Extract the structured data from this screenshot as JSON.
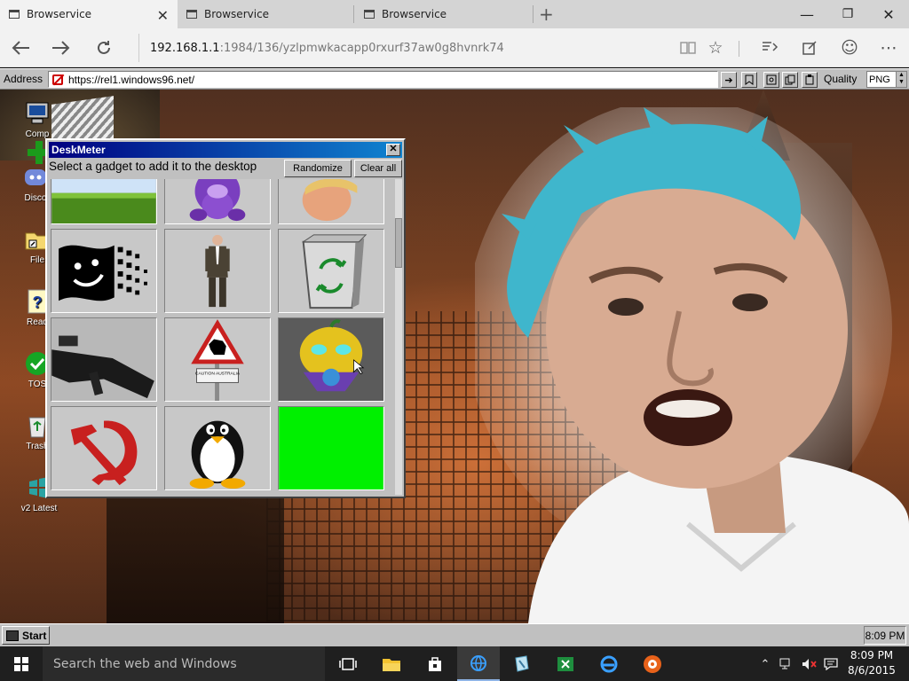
{
  "tabs": [
    {
      "title": "Browservice",
      "active": true
    },
    {
      "title": "Browservice",
      "active": false
    },
    {
      "title": "Browservice",
      "active": false
    }
  ],
  "window_controls": {
    "minimize": "—",
    "restore": "❐",
    "close": "✕"
  },
  "navbar": {
    "url_host": "192.168.1.1",
    "url_path": ":1984/136/yzlpmwkacapp0rxurf37aw0g8hvnrk74"
  },
  "w96_address": {
    "label": "Address",
    "url": "https://rel1.windows96.net/",
    "quality_label": "Quality",
    "format_value": "PNG"
  },
  "desktop_icons": [
    {
      "label": "Comp",
      "icon": "computer-icon"
    },
    {
      "label": "",
      "icon": "install-icon"
    },
    {
      "label": "Disco",
      "icon": "discord-icon"
    },
    {
      "label": "File",
      "icon": "folder-icon"
    },
    {
      "label": "Read",
      "icon": "help-icon"
    },
    {
      "label": "TOS",
      "icon": "checkmark-icon"
    },
    {
      "label": "Trash",
      "icon": "trash-icon"
    },
    {
      "label": "v2 Latest",
      "icon": "windows-logo-icon"
    }
  ],
  "deskmeter": {
    "title": "DeskMeter",
    "prompt": "Select a gadget to add it to the desktop",
    "randomize_label": "Randomize",
    "clear_label": "Clear all",
    "close_glyph": "✕",
    "gadgets": [
      {
        "name": "grass-gadget"
      },
      {
        "name": "purple-gorilla-gadget"
      },
      {
        "name": "face-head-gadget"
      },
      {
        "name": "winamp-smile-flag-gadget"
      },
      {
        "name": "man-in-suit-gadget"
      },
      {
        "name": "recycle-bin-gadget"
      },
      {
        "name": "gun-gadget"
      },
      {
        "name": "caution-australia-sign-gadget",
        "sign_text": "CAUTION AUSTRALIA"
      },
      {
        "name": "pumpkin-globe-gadget",
        "selected": true
      },
      {
        "name": "hammer-and-sickle-gadget"
      },
      {
        "name": "tux-penguin-gadget"
      },
      {
        "name": "green-square-gadget"
      }
    ]
  },
  "w96_taskbar": {
    "start_label": "Start",
    "clock": "8:09 PM"
  },
  "w10_taskbar": {
    "search_placeholder": "Search the web and Windows",
    "time": "8:09 PM",
    "date": "8/6/2015",
    "apps": [
      "task-view-icon",
      "file-explorer-icon",
      "store-icon",
      "edge-icon",
      "paint-icon",
      "excel-icon",
      "ie-icon",
      "media-icon"
    ]
  },
  "colors": {
    "titlebar_start": "#000080",
    "titlebar_end": "#1084d0",
    "win96_face": "#c0c0c0",
    "w10_taskbar": "#1f1f1f"
  }
}
